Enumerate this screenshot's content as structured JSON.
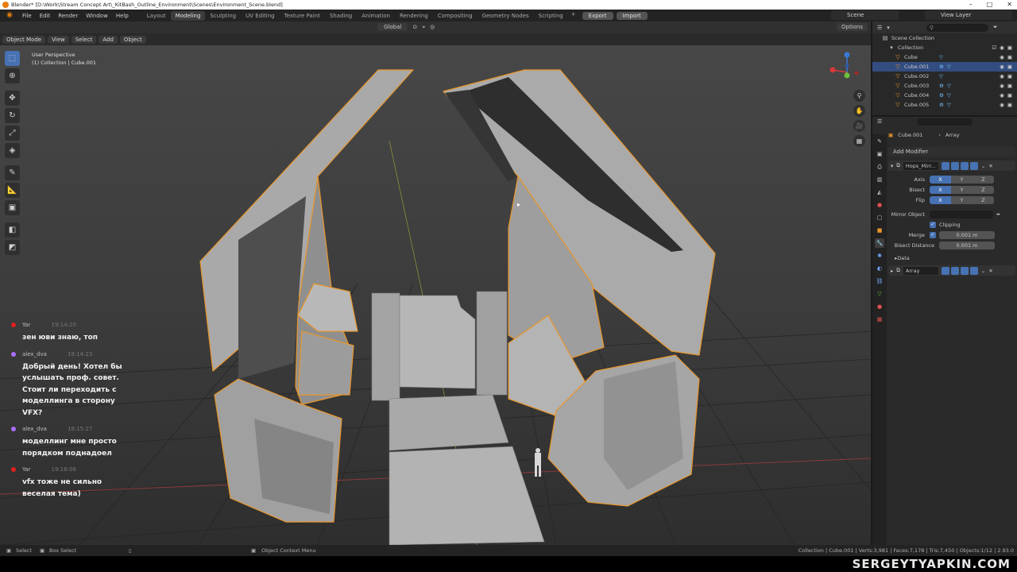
{
  "titlebar": {
    "text": "Blender* [D:\\Work\\Stream Concept Art\\_KitBash_Outline_Environment\\Scenes\\Environment_Scene.blend]"
  },
  "menu": [
    "File",
    "Edit",
    "Render",
    "Window",
    "Help"
  ],
  "workspaces": [
    "Layout",
    "Modeling",
    "Sculpting",
    "UV Editing",
    "Texture Paint",
    "Shading",
    "Animation",
    "Rendering",
    "Compositing",
    "Geometry Nodes",
    "Scripting"
  ],
  "active_workspace": "Modeling",
  "header_buttons": {
    "export": "Export",
    "import": "Import"
  },
  "scene_name": "Scene",
  "view_layer": "View Layer",
  "viewport_header": {
    "mode": "Object Mode",
    "view": "View",
    "select": "Select",
    "add": "Add",
    "object": "Object",
    "orientation": "Global",
    "options": "Options"
  },
  "viewport_info": {
    "perspective": "User Perspective",
    "collection": "(1) Collection | Cube.001"
  },
  "chat": [
    {
      "user": "Yar",
      "time": "19:14:20",
      "color": "#e02020",
      "text": "зен юви знаю, топ"
    },
    {
      "user": "alex_dva",
      "time": "19:14:23",
      "color": "#a970ff",
      "text": "Добрый день! Хотел бы услышать проф. совет. Стоит ли переходить с моделлинга в сторону VFX?"
    },
    {
      "user": "alex_dva",
      "time": "19:15:27",
      "color": "#a970ff",
      "text": "моделлинг мне просто порядком поднадоел"
    },
    {
      "user": "Yar",
      "time": "19:16:06",
      "color": "#e02020",
      "text": "vfx тоже не сильно веселая тема)"
    }
  ],
  "outliner": {
    "root": "Scene Collection",
    "collection": "Collection",
    "items": [
      "Cube",
      "Cube.001",
      "Cube.002",
      "Cube.003",
      "Cube.004",
      "Cube.005"
    ],
    "selected": "Cube.001"
  },
  "properties": {
    "object": "Cube.001",
    "modifier_context": "Array",
    "add_modifier": "Add Modifier",
    "modifier1_name": "Hops_Mirr...",
    "axis_label": "Axis",
    "bisect_label": "Bisect",
    "flip_label": "Flip",
    "xyz": [
      "X",
      "Y",
      "Z"
    ],
    "mirror_object_label": "Mirror Object",
    "clipping_label": "Clipping",
    "merge_label": "Merge",
    "merge_value": "0.001 m",
    "bisect_distance_label": "Bisect Distance",
    "bisect_distance_value": "0.001 m",
    "data_label": "Data",
    "modifier2_name": "Array"
  },
  "statusbar": {
    "select": "Select",
    "box_select": "Box Select",
    "context_menu": "Object Context Menu",
    "stats": "Collection | Cube.001 | Verts:3,981 | Faces:7,178 | Tris:7,450 | Objects:1/12 | 2.93.0"
  },
  "watermark": "SERGEYTYAPKIN.COM",
  "colors": {
    "accent": "#4772b3",
    "selection_outline": "#e8962c",
    "blender_orange": "#e87d0d"
  }
}
